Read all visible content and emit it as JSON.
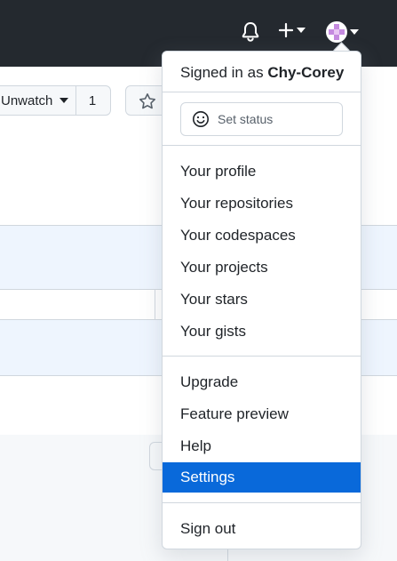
{
  "header": {
    "bell_icon": "bell-icon",
    "create_icon": "plus-icon",
    "avatar_icon": "avatar"
  },
  "repo": {
    "unwatch_label": "Unwatch",
    "watch_count": "1",
    "star_icon": "star-icon"
  },
  "menu": {
    "signed_in_prefix": "Signed in as",
    "username": "Chy-Corey",
    "set_status": "Set status",
    "section1": [
      "Your profile",
      "Your repositories",
      "Your codespaces",
      "Your projects",
      "Your stars",
      "Your gists"
    ],
    "section2": [
      "Upgrade",
      "Feature preview",
      "Help",
      "Settings"
    ],
    "active_item": "Settings",
    "sign_out": "Sign out"
  },
  "colors": {
    "header_bg": "#24292f",
    "accent": "#0969da",
    "highlight_row": "#eef5fe"
  }
}
